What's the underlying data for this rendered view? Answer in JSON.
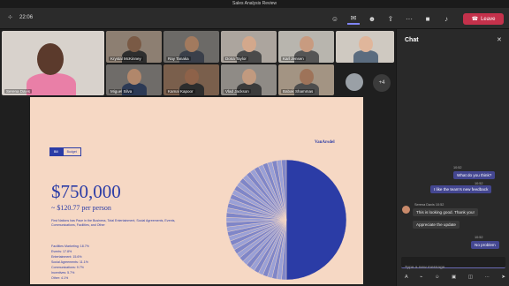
{
  "window": {
    "title": "Sales Analysis Review"
  },
  "toolbar": {
    "timer": "22:06",
    "leave_label": "Leave",
    "icons": [
      "grid-icon",
      "people-icon",
      "chat-icon",
      "reactions-icon",
      "share-icon",
      "more-icon",
      "camera-icon",
      "mic-icon",
      "leave-phone-icon"
    ]
  },
  "gallery": {
    "participants": [
      {
        "name": "Serena Davis"
      },
      {
        "name": "Krystal McKinney"
      },
      {
        "name": "Ray Tanaka"
      },
      {
        "name": "Dona Taylor"
      },
      {
        "name": "Karl Jensen"
      },
      {
        "name": "Miguel Silva"
      },
      {
        "name": "Kamal Kapoor"
      },
      {
        "name": "Vlad Jackson"
      },
      {
        "name": "Babak Shammas"
      }
    ],
    "overflow_count": "+4"
  },
  "slide": {
    "tabs": [
      "Bill",
      "Budget"
    ],
    "brand": "VanArsdel",
    "amount": "$750,000",
    "per_person": "~ $120.77 per person",
    "description": "First Nations has Pace in the Business, Total Entertainment, Social Agreements, Events, Communications, Facilities, and Other",
    "items": [
      "Facilities Marketing: 18.7%",
      "Events: 17.8%",
      "Entertainment: 15.6%",
      "Social Agreements: 11.1%",
      "Communications: 9.7%",
      "Incentives: 5.7%",
      "Other: 4.1%"
    ]
  },
  "chat": {
    "title": "Chat",
    "messages": [
      {
        "dir": "out",
        "meta": "10:52",
        "text": "What do you think?"
      },
      {
        "dir": "out",
        "meta": "10:52",
        "text": "I like the team's new feedback"
      },
      {
        "dir": "in",
        "meta": "Serena Davis 10:52",
        "text": "This is looking good. Thank you!"
      },
      {
        "dir": "in",
        "meta": "",
        "text": "Appreciate the update"
      },
      {
        "dir": "out",
        "meta": "10:52",
        "text": "No problem"
      }
    ],
    "compose_placeholder": "Type a new message",
    "tools": [
      "format-icon",
      "attach-icon",
      "emoji-icon",
      "gif-icon",
      "sticker-icon",
      "more-icon",
      "send-icon"
    ]
  },
  "colors": {
    "accent": "#444791",
    "slide_blue": "#2b3ca6",
    "slide_bg": "#f6d8c4",
    "leave": "#c4314b"
  }
}
